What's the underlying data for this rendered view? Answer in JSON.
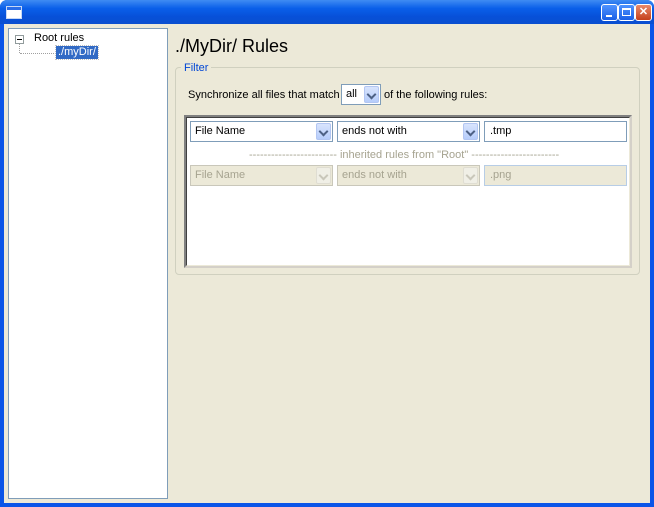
{
  "window": {
    "title": ""
  },
  "tree": {
    "root_label": "Root rules",
    "child_label": "./myDir/"
  },
  "page": {
    "title": "./MyDir/ Rules"
  },
  "filter": {
    "legend": "Filter",
    "sync_prefix": "Synchronize all files that match",
    "match_value": "all",
    "sync_suffix": "of the following rules:"
  },
  "rules": [
    {
      "field": "File Name",
      "condition": "ends not with",
      "value": ".tmp",
      "enabled": true
    }
  ],
  "inherited_separator": "------------------------ inherited rules from \"Root\" ------------------------",
  "inherited_rules": [
    {
      "field": "File Name",
      "condition": "ends not with",
      "value": ".png",
      "enabled": false
    }
  ],
  "colors": {
    "title_bar": "#0a55e8",
    "selection": "#316ac5",
    "group_legend": "#0046d5",
    "client_bg": "#ece9d8"
  }
}
